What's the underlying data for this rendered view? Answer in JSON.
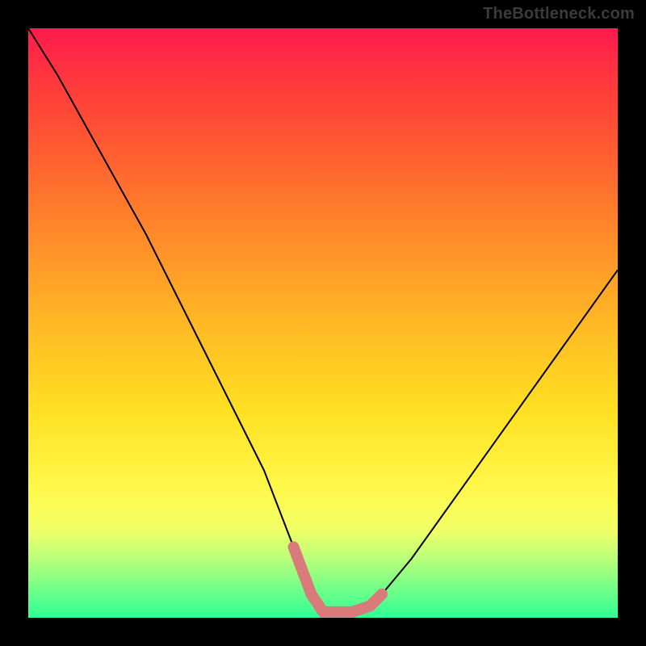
{
  "watermark": "TheBottleneck.com",
  "chart_data": {
    "type": "line",
    "title": "",
    "xlabel": "",
    "ylabel": "",
    "xlim": [
      0,
      100
    ],
    "ylim": [
      0,
      100
    ],
    "series": [
      {
        "name": "bottleneck-curve",
        "x": [
          0,
          5,
          10,
          15,
          20,
          25,
          30,
          35,
          40,
          45,
          48,
          50,
          52,
          55,
          58,
          60,
          65,
          70,
          75,
          80,
          85,
          90,
          95,
          100
        ],
        "values": [
          100,
          92,
          83,
          74,
          65,
          55,
          45,
          35,
          25,
          12,
          4,
          1,
          1,
          1,
          2,
          4,
          10,
          17,
          24,
          31,
          38,
          45,
          52,
          59
        ]
      }
    ],
    "annotations": [
      {
        "name": "highlight-range",
        "x_start": 45,
        "x_end": 60,
        "color": "#d97b7b"
      }
    ],
    "gradient_stops": [
      {
        "pos": 0,
        "color": "#ff1a4d"
      },
      {
        "pos": 22,
        "color": "#ff6030"
      },
      {
        "pos": 50,
        "color": "#ffb824"
      },
      {
        "pos": 78,
        "color": "#fff84a"
      },
      {
        "pos": 100,
        "color": "#2fff95"
      }
    ]
  }
}
